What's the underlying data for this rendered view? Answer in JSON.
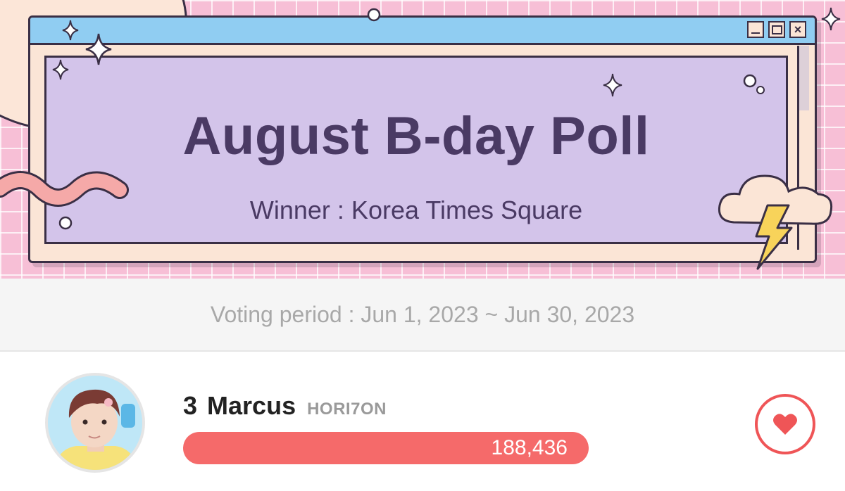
{
  "banner": {
    "title": "August B-day Poll",
    "subtitle": "Winner : Korea Times Square",
    "window_buttons": [
      "minimize-icon",
      "maximize-icon",
      "close-icon"
    ]
  },
  "voting_period": {
    "label": "Voting period : ",
    "range": "Jun 1, 2023 ~ Jun 30, 2023"
  },
  "candidates": [
    {
      "rank": "3",
      "name": "Marcus",
      "group": "HORI7ON",
      "votes": "188,436",
      "vote_button_icon": "heart-icon"
    }
  ],
  "colors": {
    "banner_pink": "#f7bfd6",
    "window_lavender": "#d3c4ea",
    "titlebar_blue": "#90cdf2",
    "title_text": "#4a3a64",
    "vote_bar": "#f56a6a",
    "heart": "#ef5557"
  }
}
